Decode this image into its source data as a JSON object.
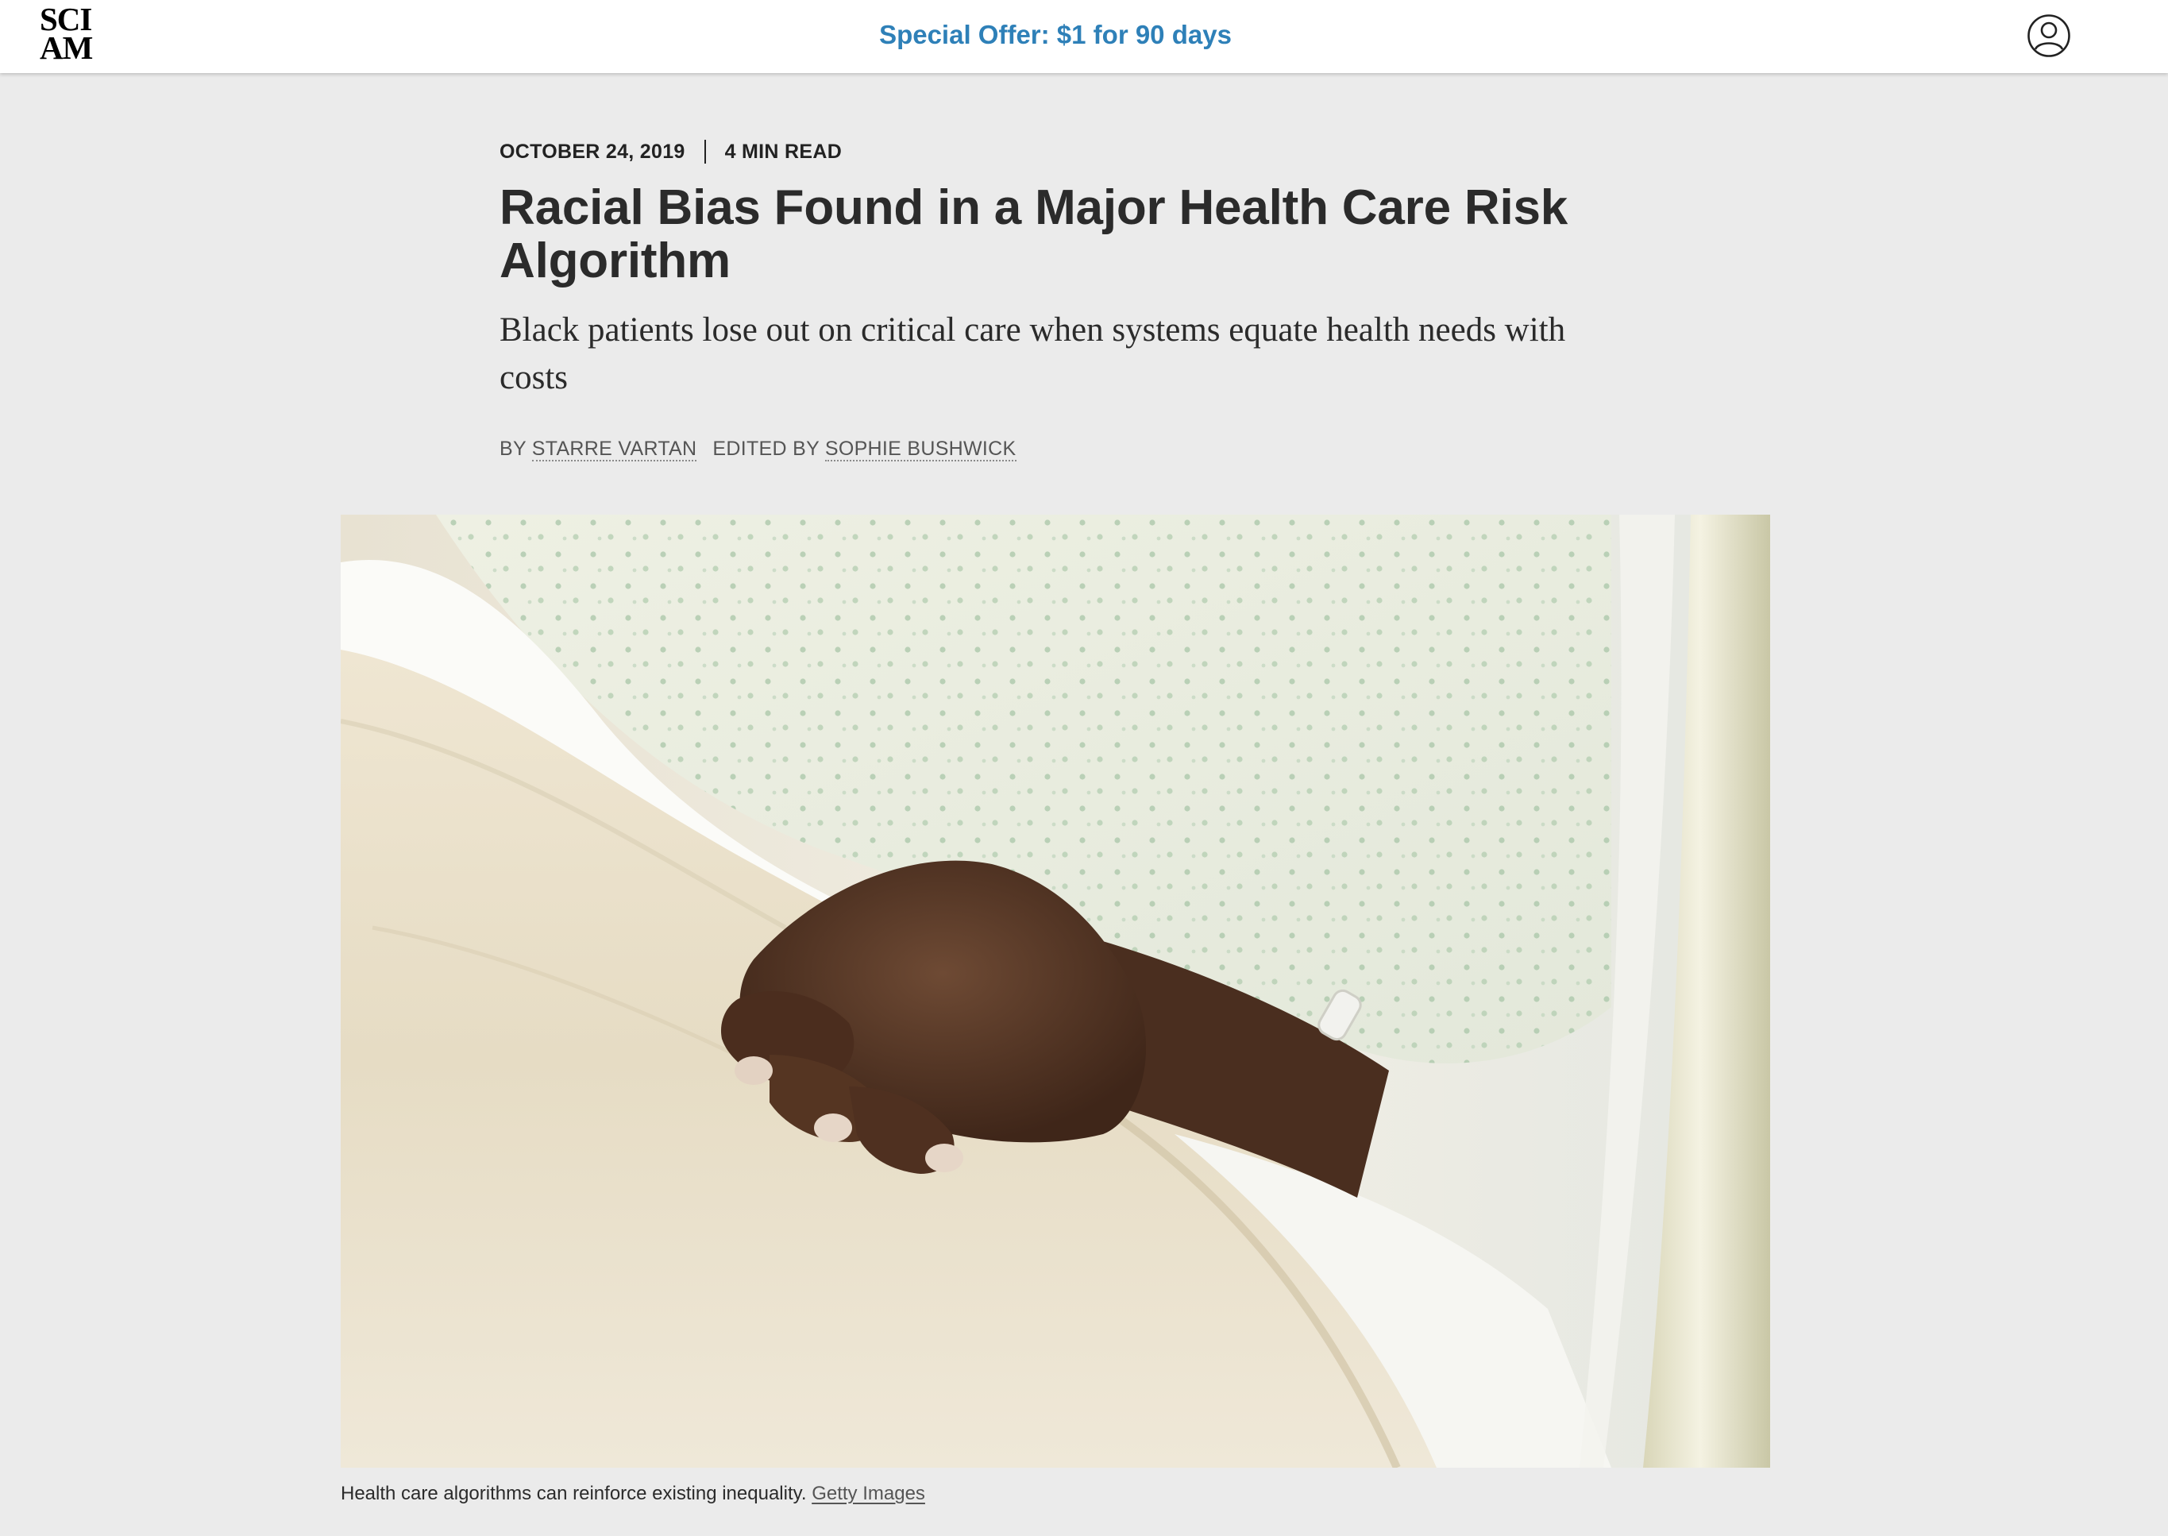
{
  "header": {
    "logo_line1": "SCI",
    "logo_line2": "AM",
    "offer_text": "Special Offer: $1 for 90 days",
    "offer_color": "#2e80b8",
    "account_icon": "user-circle-icon"
  },
  "article": {
    "date": "OCTOBER 24, 2019",
    "read_time": "4 MIN READ",
    "title": "Racial Bias Found in a Major Health Care Risk Algorithm",
    "dek": "Black patients lose out on critical care when systems equate health needs with costs",
    "by_label": "BY",
    "author": "STARRE VARTAN",
    "edited_label": "EDITED BY",
    "editor": "SOPHIE BUSHWICK"
  },
  "hero": {
    "caption": "Health care algorithms can reinforce existing inequality.",
    "credit": "Getty Images"
  },
  "colors": {
    "page_background": "#ebebeb",
    "text": "#2b2b2b"
  }
}
